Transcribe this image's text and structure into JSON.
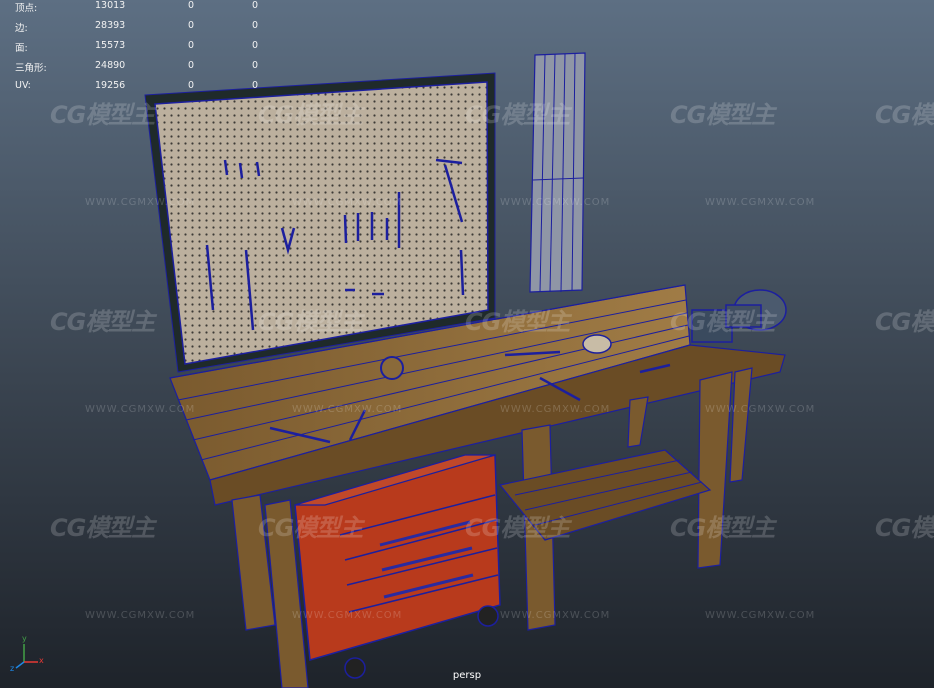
{
  "hud": {
    "rows": [
      {
        "label": "顶点:",
        "v1": "13013",
        "v2": "0",
        "v3": "0"
      },
      {
        "label": "边:",
        "v1": "28393",
        "v2": "0",
        "v3": "0"
      },
      {
        "label": "面:",
        "v1": "15573",
        "v2": "0",
        "v3": "0"
      },
      {
        "label": "三角形:",
        "v1": "24890",
        "v2": "0",
        "v3": "0"
      },
      {
        "label": "UV:",
        "v1": "19256",
        "v2": "0",
        "v3": "0"
      }
    ]
  },
  "camera_label": "persp",
  "axis": {
    "y": "y",
    "x": "x",
    "z": "z"
  },
  "watermark": {
    "brand": "CG模型主",
    "site": "WWW.CGMXW.COM"
  },
  "colors": {
    "wireframe": "#1c1f9e",
    "wood": "#8a6a3a",
    "pegboard": "#b8ad9c",
    "toolchest": "#b83a1c",
    "axis_x": "#e53935",
    "axis_y": "#43a047",
    "axis_z": "#1e88e5"
  }
}
